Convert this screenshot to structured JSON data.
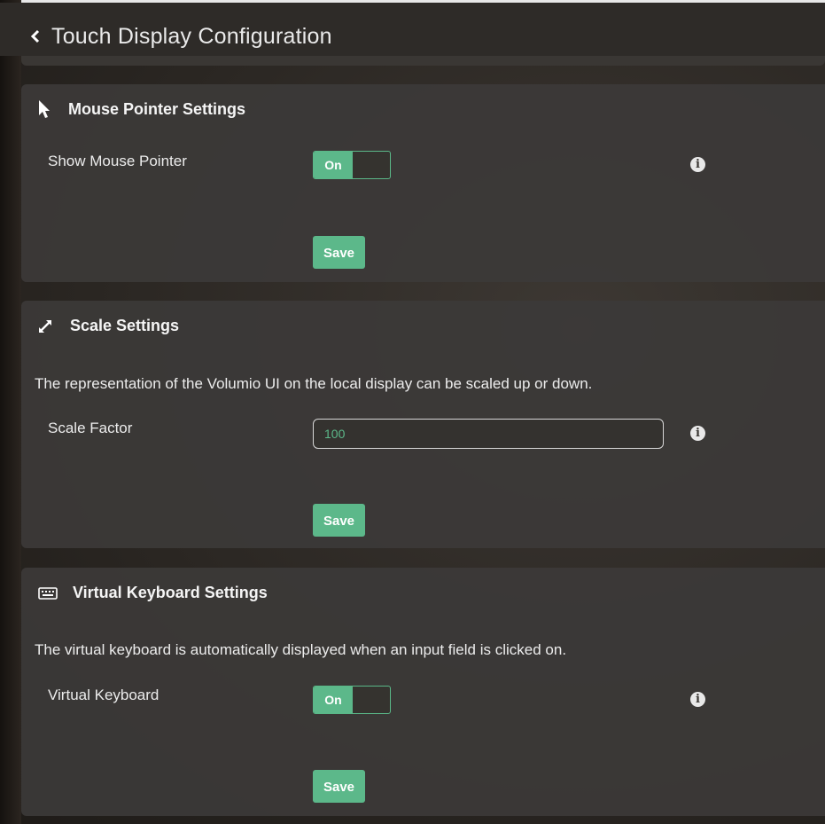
{
  "header": {
    "title": "Touch Display Configuration",
    "back_icon": "chevron-left-icon"
  },
  "sections": {
    "mouse": {
      "title": "Mouse Pointer Settings",
      "icon": "mouse-pointer-icon",
      "row_label": "Show Mouse Pointer",
      "toggle_label": "On",
      "save_label": "Save"
    },
    "scale": {
      "title": "Scale Settings",
      "icon": "expand-arrows-icon",
      "description": "The representation of the Volumio UI on the local display can be scaled up or down.",
      "row_label": "Scale Factor",
      "value": "100",
      "save_label": "Save"
    },
    "keyboard": {
      "title": "Virtual Keyboard Settings",
      "icon": "keyboard-icon",
      "description": "The virtual keyboard is automatically displayed when an input field is clicked on.",
      "row_label": "Virtual Keyboard",
      "toggle_label": "On",
      "save_label": "Save"
    }
  },
  "colors": {
    "accent": "#5cb88a",
    "panel": "#3c3a38",
    "text": "#f2f2f2"
  }
}
